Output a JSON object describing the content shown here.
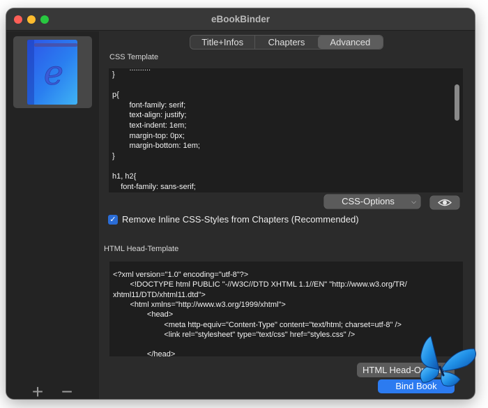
{
  "window": {
    "title": "eBookBinder"
  },
  "sidebar": {
    "book_icon_letter": "e",
    "book_icon": "blue-book-icon",
    "add_label": "+",
    "remove_label": "−"
  },
  "tabs": [
    {
      "label": "Title+Infos",
      "selected": false
    },
    {
      "label": "Chapters",
      "selected": false
    },
    {
      "label": "Advanced",
      "selected": true
    }
  ],
  "css_section": {
    "label": "CSS Template",
    "code_lines": [
      "}",
      "",
      "p{",
      "        font-family: serif;",
      "        text-align: justify;",
      "        text-indent: 1em;",
      "        margin-top: 0px;",
      "        margin-bottom: 1em;",
      "}",
      "",
      "h1, h2{",
      "    font-family: sans-serif;"
    ],
    "options_label": "CSS-Options",
    "preview_icon": "eye-icon"
  },
  "remove_inline": {
    "checked": true,
    "label": "Remove Inline CSS-Styles from Chapters (Recommended)"
  },
  "html_section": {
    "label": "HTML Head-Template",
    "code_lines": [
      "<?xml version=\"1.0\" encoding=\"utf-8\"?>",
      "        <!DOCTYPE html PUBLIC \"-//W3C//DTD XHTML 1.1//EN\" \"http://www.w3.org/TR/",
      "xhtml11/DTD/xhtml11.dtd\">",
      "        <html xmlns=\"http://www.w3.org/1999/xhtml\">",
      "                <head>",
      "                        <meta http-equiv=\"Content-Type\" content=\"text/html; charset=utf-8\" />",
      "                        <link rel=\"stylesheet\" type=\"text/css\" href=\"styles.css\" />",
      "",
      "                </head>"
    ],
    "options_label": "HTML Head-Options"
  },
  "footer": {
    "bind_label": "Bind Book"
  },
  "colors": {
    "accent": "#2c7bf0",
    "window_bg": "#2b2b2b",
    "editor_bg": "#1e1e1e",
    "butterfly": "#1f8fe6"
  }
}
